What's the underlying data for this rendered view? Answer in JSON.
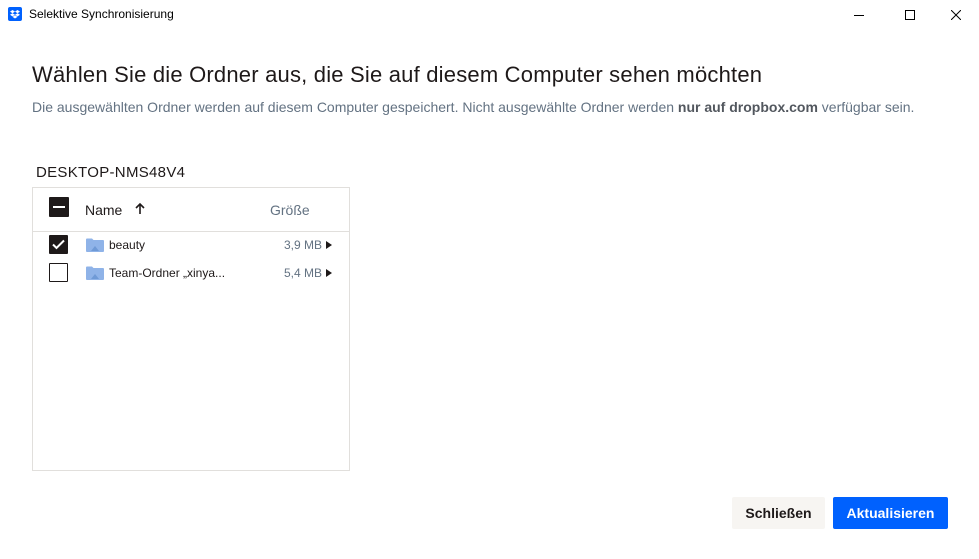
{
  "window": {
    "title": "Selektive Synchronisierung",
    "app_icon": "dropbox-icon",
    "controls": [
      "minimize-icon",
      "maximize-icon",
      "close-icon"
    ]
  },
  "heading": "Wählen Sie die Ordner aus, die Sie auf diesem Computer sehen möchten",
  "description": {
    "before": "Die ausgewählten Ordner werden auf diesem Computer gespeichert. Nicht ausgewählte Ordner werden ",
    "bold": "nur auf dropbox.com",
    "after": " verfügbar sein."
  },
  "device_name": "DESKTOP-NMS48V4",
  "table": {
    "header": {
      "name": "Name",
      "size": "Größe",
      "sort": "ascending",
      "select_all_state": "indeterminate"
    },
    "rows": [
      {
        "name": "beauty",
        "size": "3,9 MB",
        "checked": true
      },
      {
        "name": "Team-Ordner „xinya...",
        "size": "5,4 MB",
        "checked": false
      }
    ]
  },
  "buttons": {
    "close": "Schließen",
    "update": "Aktualisieren"
  },
  "colors": {
    "accent": "#0061fe",
    "text": "#1e1919",
    "muted": "#637282",
    "folder": "#8fb3e8"
  }
}
